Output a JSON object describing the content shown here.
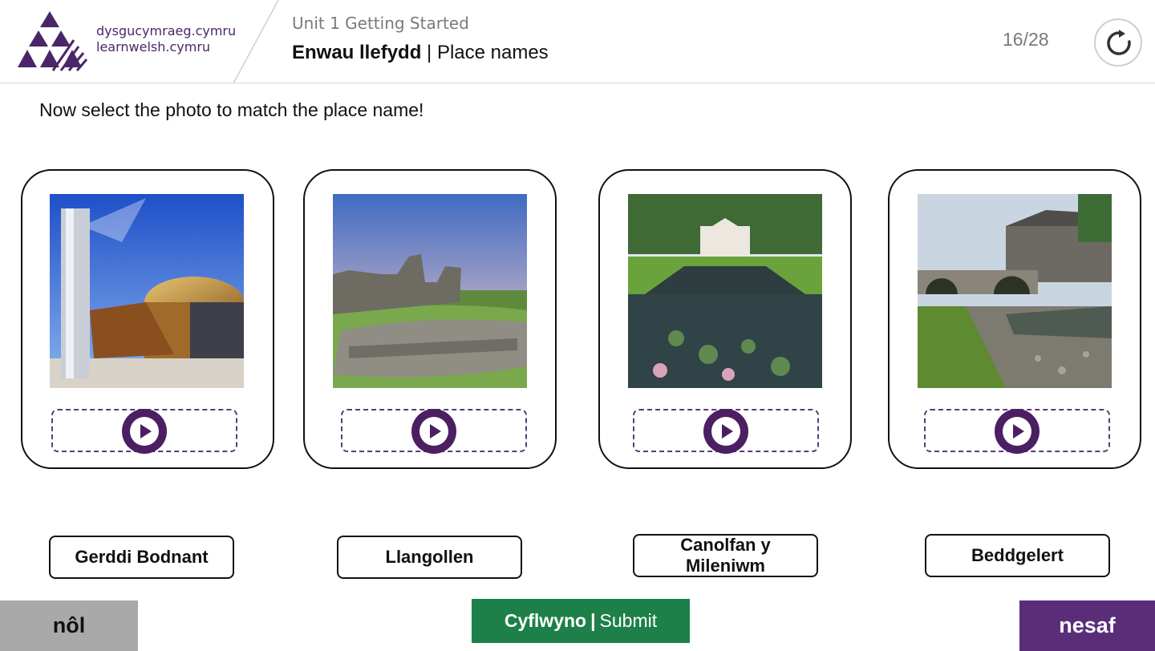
{
  "brand": {
    "line1": "dysgucymraeg.cymru",
    "line2": "learnwelsh.cymru",
    "color": "#4a2668"
  },
  "header": {
    "unit_title": "Unit 1 Getting Started",
    "lesson_title_welsh": "Enwau llefydd",
    "lesson_separator": "|",
    "lesson_title_english": "Place names",
    "progress": "16/28",
    "reset_icon": "refresh-icon"
  },
  "instruction": "Now select the photo to match the place name!",
  "cards": [
    {
      "photo": "cardiff-bay-millennium-centre-photo",
      "play_icon": "play-icon"
    },
    {
      "photo": "castle-ruins-sunset-photo",
      "play_icon": "play-icon"
    },
    {
      "photo": "garden-canal-pavilion-photo",
      "play_icon": "play-icon"
    },
    {
      "photo": "stone-bridge-village-photo",
      "play_icon": "play-icon"
    }
  ],
  "labels": [
    "Gerddi Bodnant",
    "Llangollen",
    "Canolfan y Mileniwm",
    "Beddgelert"
  ],
  "footer": {
    "back_label": "nôl",
    "submit_welsh": "Cyflwyno",
    "submit_separator": "|",
    "submit_english": "Submit",
    "next_label": "nesaf"
  },
  "colors": {
    "accent_purple": "#4b1f62",
    "next_purple": "#5a2d79",
    "submit_green": "#1e8049",
    "back_grey": "#a9a9a9"
  }
}
